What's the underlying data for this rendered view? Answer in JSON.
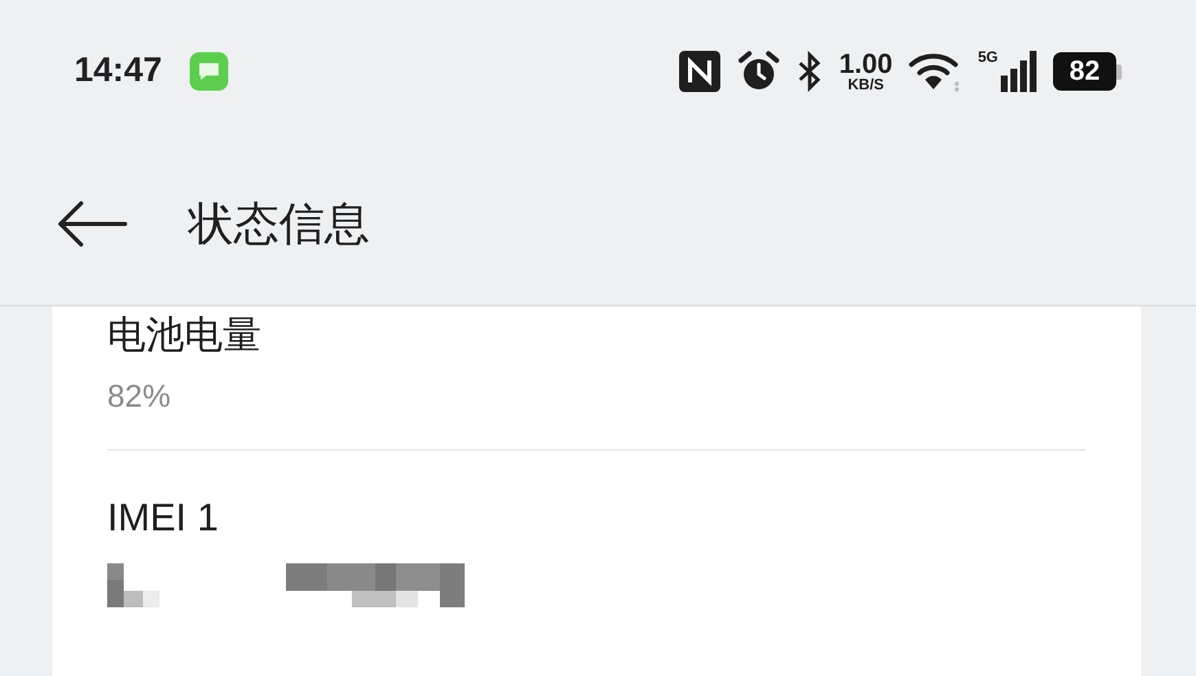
{
  "status_bar": {
    "time": "14:47",
    "net_speed_value": "1.00",
    "net_speed_unit": "KB/S",
    "network_type": "5G",
    "battery": "82"
  },
  "header": {
    "title": "状态信息"
  },
  "items": [
    {
      "kind": "text",
      "label": "电池电量",
      "value": "82%"
    },
    {
      "kind": "redacted",
      "label": "IMEI 1"
    }
  ]
}
